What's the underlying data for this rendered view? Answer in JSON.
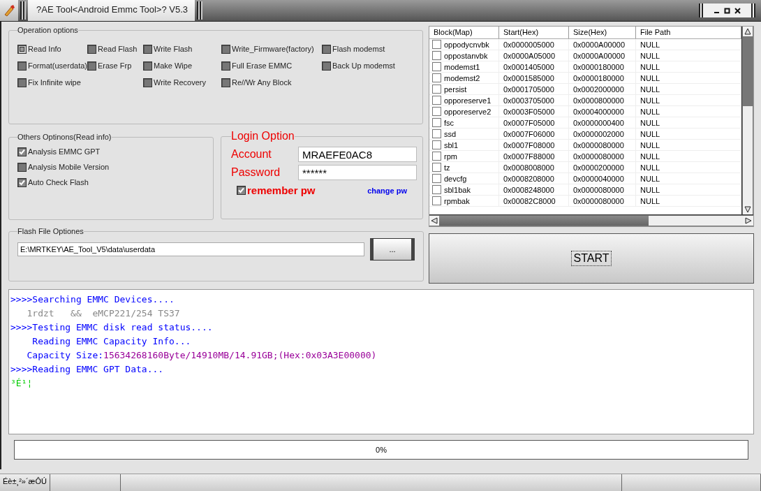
{
  "window": {
    "title": "?AE Tool<Android Emmc Tool>? V5.3"
  },
  "operation_options": {
    "title": "Operation options",
    "columns": [
      [
        {
          "label": "Read Info",
          "selected": true
        },
        {
          "label": "Format(userdata)",
          "selected": false
        },
        {
          "label": "Fix Infinite wipe",
          "selected": false
        }
      ],
      [
        {
          "label": "Read Flash",
          "selected": false
        },
        {
          "label": "Erase Frp",
          "selected": false
        }
      ],
      [
        {
          "label": "Write Flash",
          "selected": false
        },
        {
          "label": "Make Wipe",
          "selected": false
        },
        {
          "label": "Write Recovery",
          "selected": false
        }
      ],
      [
        {
          "label": "Write_Firmware(factory)",
          "selected": false
        },
        {
          "label": "Full Erase EMMC",
          "selected": false
        },
        {
          "label": "Re//Wr Any Block",
          "selected": false
        }
      ],
      [
        {
          "label": "Flash modemst",
          "selected": false
        },
        {
          "label": "Back Up modemst",
          "selected": false
        }
      ]
    ]
  },
  "other_options": {
    "title": "Others Optinons(Read info)",
    "items": [
      {
        "label": "Analysis EMMC GPT",
        "checked": true
      },
      {
        "label": "Analysis Mobile Version",
        "checked": false
      },
      {
        "label": "Auto Check Flash",
        "checked": true
      }
    ]
  },
  "login": {
    "title": "Login Option",
    "account_label": "Account",
    "account": "MRAEFE0AC8",
    "password_label": "Password",
    "password": "******",
    "remember": {
      "label": "remember pw",
      "checked": true
    },
    "change_link": "change pw"
  },
  "flash_file": {
    "title": "Flash File Optiones",
    "path": "E:\\MRTKEY\\AE_Tool_V5\\data\\userdata",
    "browse": "..."
  },
  "table": {
    "columns": [
      "Block(Map)",
      "Start(Hex)",
      "Size(Hex)",
      "File Path"
    ],
    "rows": [
      {
        "checked": false,
        "cells": [
          "oppodycnvbk",
          "0x0000005000",
          "0x0000A00000",
          "NULL"
        ]
      },
      {
        "checked": false,
        "cells": [
          "oppostanvbk",
          "0x0000A05000",
          "0x0000A00000",
          "NULL"
        ]
      },
      {
        "checked": false,
        "cells": [
          "modemst1",
          "0x0001405000",
          "0x0000180000",
          "NULL"
        ]
      },
      {
        "checked": false,
        "cells": [
          "modemst2",
          "0x0001585000",
          "0x0000180000",
          "NULL"
        ]
      },
      {
        "checked": false,
        "cells": [
          "persist",
          "0x0001705000",
          "0x0002000000",
          "NULL"
        ]
      },
      {
        "checked": false,
        "cells": [
          "opporeserve1",
          "0x0003705000",
          "0x0000800000",
          "NULL"
        ]
      },
      {
        "checked": false,
        "cells": [
          "opporeserve2",
          "0x0003F05000",
          "0x0004000000",
          "NULL"
        ]
      },
      {
        "checked": false,
        "cells": [
          "fsc",
          "0x0007F05000",
          "0x0000000400",
          "NULL"
        ]
      },
      {
        "checked": false,
        "cells": [
          "ssd",
          "0x0007F06000",
          "0x0000002000",
          "NULL"
        ]
      },
      {
        "checked": false,
        "cells": [
          "sbl1",
          "0x0007F08000",
          "0x0000080000",
          "NULL"
        ]
      },
      {
        "checked": false,
        "cells": [
          "rpm",
          "0x0007F88000",
          "0x0000080000",
          "NULL"
        ]
      },
      {
        "checked": false,
        "cells": [
          "tz",
          "0x0008008000",
          "0x0000200000",
          "NULL"
        ]
      },
      {
        "checked": false,
        "cells": [
          "devcfg",
          "0x0008208000",
          "0x0000040000",
          "NULL"
        ]
      },
      {
        "checked": false,
        "cells": [
          "sbl1bak",
          "0x0008248000",
          "0x0000080000",
          "NULL"
        ]
      },
      {
        "checked": false,
        "cells": [
          "rpmbak",
          "0x00082C8000",
          "0x0000080000",
          "NULL"
        ]
      }
    ]
  },
  "start_button": "START",
  "log": [
    {
      "kind": "step",
      "text": ">>>>Searching EMMC Devices...."
    },
    {
      "kind": "info",
      "text": "   1rdzt   &&  eMCP221/254 TS37"
    },
    {
      "kind": "step",
      "text": ">>>>Testing EMMC disk read status...."
    },
    {
      "kind": "step",
      "text": "    Reading EMMC Capacity Info..."
    },
    {
      "kind": "capacity",
      "label": "   Capacity Size:",
      "value": "15634268160Byte/14910MB/14.91GB;(Hex:0x03A3E00000)"
    },
    {
      "kind": "step",
      "text": ">>>>Reading EMMC GPT Data..."
    },
    {
      "kind": "garbled",
      "text": "³É¹¦"
    }
  ],
  "progress": {
    "level": 0,
    "text": "0%"
  },
  "status_bar": [
    "Éè±¸²»´æÔÚ"
  ]
}
